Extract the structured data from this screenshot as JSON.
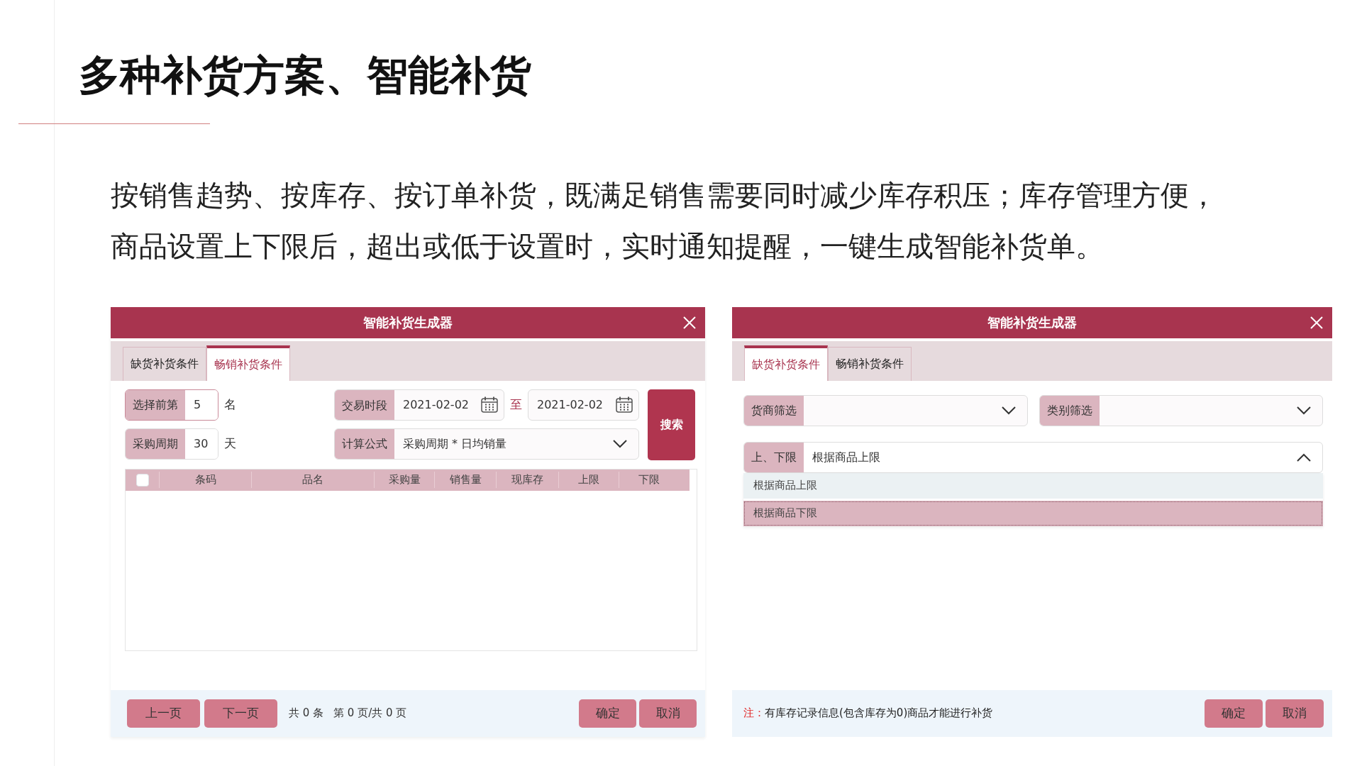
{
  "slide_title": "多种补货方案、智能补货",
  "description": [
    "按销售趋势、按库存、按订单补货，既满足销售需要同时减少库存积压；库存管理方便，",
    "商品设置上下限后，超出或低于设置时，实时通知提醒，一键生成智能补货单。"
  ],
  "left_dialog": {
    "title": "智能补货生成器",
    "tabs": [
      {
        "label": "缺货补货条件",
        "selected": false
      },
      {
        "label": "畅销补货条件",
        "selected": true
      }
    ],
    "top_n": {
      "label": "选择前第",
      "value": "5",
      "unit": "名"
    },
    "purchase_cycle": {
      "label": "采购周期",
      "value": "30",
      "unit": "天"
    },
    "period": {
      "label": "交易时段",
      "from": "2021-02-02",
      "separator": "至",
      "to": "2021-02-02"
    },
    "formula": {
      "label": "计算公式",
      "value": "采购周期 * 日均销量"
    },
    "search_button": "搜索",
    "table": {
      "select_all_checked": false,
      "columns": [
        "条码",
        "品名",
        "采购量",
        "销售量",
        "现库存",
        "上限",
        "下限"
      ]
    },
    "pager": {
      "prev": "上一页",
      "next": "下一页",
      "total": "共 0 条",
      "page": "第 0 页/共 0 页"
    },
    "buttons": [
      "确定",
      "取消"
    ]
  },
  "right_dialog": {
    "title": "智能补货生成器",
    "tabs": [
      {
        "label": "缺货补货条件",
        "selected": true
      },
      {
        "label": "畅销补货条件",
        "selected": false
      }
    ],
    "vendor_filter": {
      "label": "货商筛选"
    },
    "category_filter": {
      "label": "类别筛选"
    },
    "limit_select": {
      "label": "上、下限",
      "value": "根据商品上限",
      "expanded": true,
      "options": [
        {
          "label": "根据商品上限",
          "selected": true,
          "hovered": false
        },
        {
          "label": "根据商品下限",
          "selected": false,
          "hovered": true
        }
      ]
    },
    "note": {
      "label": "注：",
      "text": "有库存记录信息(包含库存为0)商品才能进行补货"
    },
    "buttons": [
      "确定",
      "取消"
    ]
  }
}
